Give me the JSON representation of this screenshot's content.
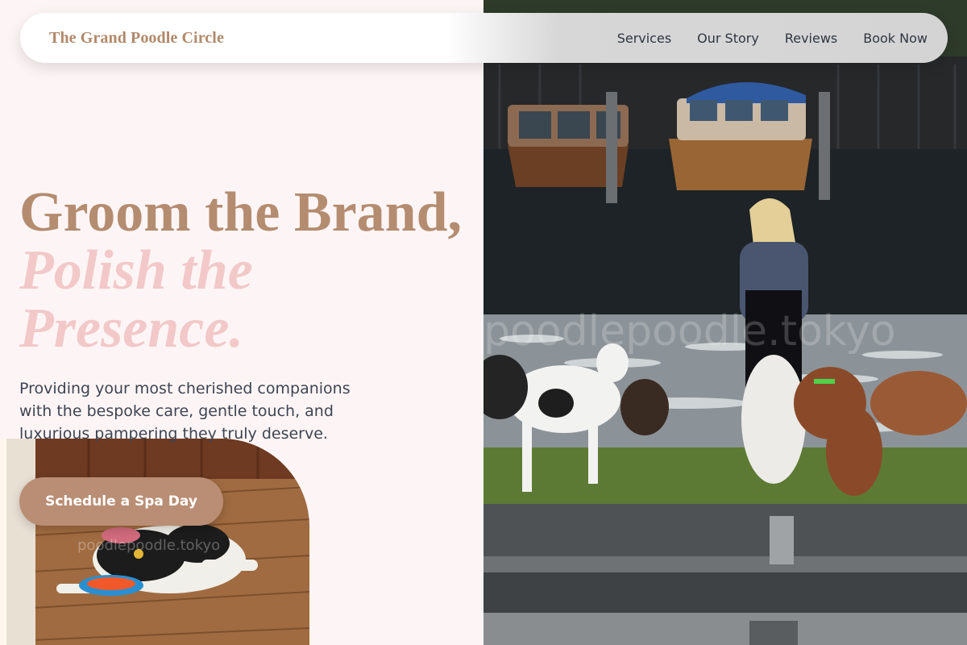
{
  "header": {
    "brand": "The Grand Poodle Circle",
    "nav": [
      "Services",
      "Our Story",
      "Reviews",
      "Book Now"
    ]
  },
  "hero": {
    "headline_line1": "Groom the Brand,",
    "headline_line2": "Polish the",
    "headline_line3": "Presence.",
    "description": "Providing your most cherished companions with the bespoke care, gentle touch, and luxurious pampering they truly deserve.",
    "cta_label": "Schedule a Spa Day"
  },
  "images": {
    "hero_photo": {
      "watermark": "poodlepoodle.tokyo"
    },
    "corner_photo": {
      "watermark": "poodlepoodle.tokyo"
    }
  },
  "colors": {
    "page_background": "#fdf5f5",
    "brand": "#b1896a",
    "headline": "#b48c70",
    "headline_accent": "#f2c8c8",
    "cta": "#b98e74"
  }
}
